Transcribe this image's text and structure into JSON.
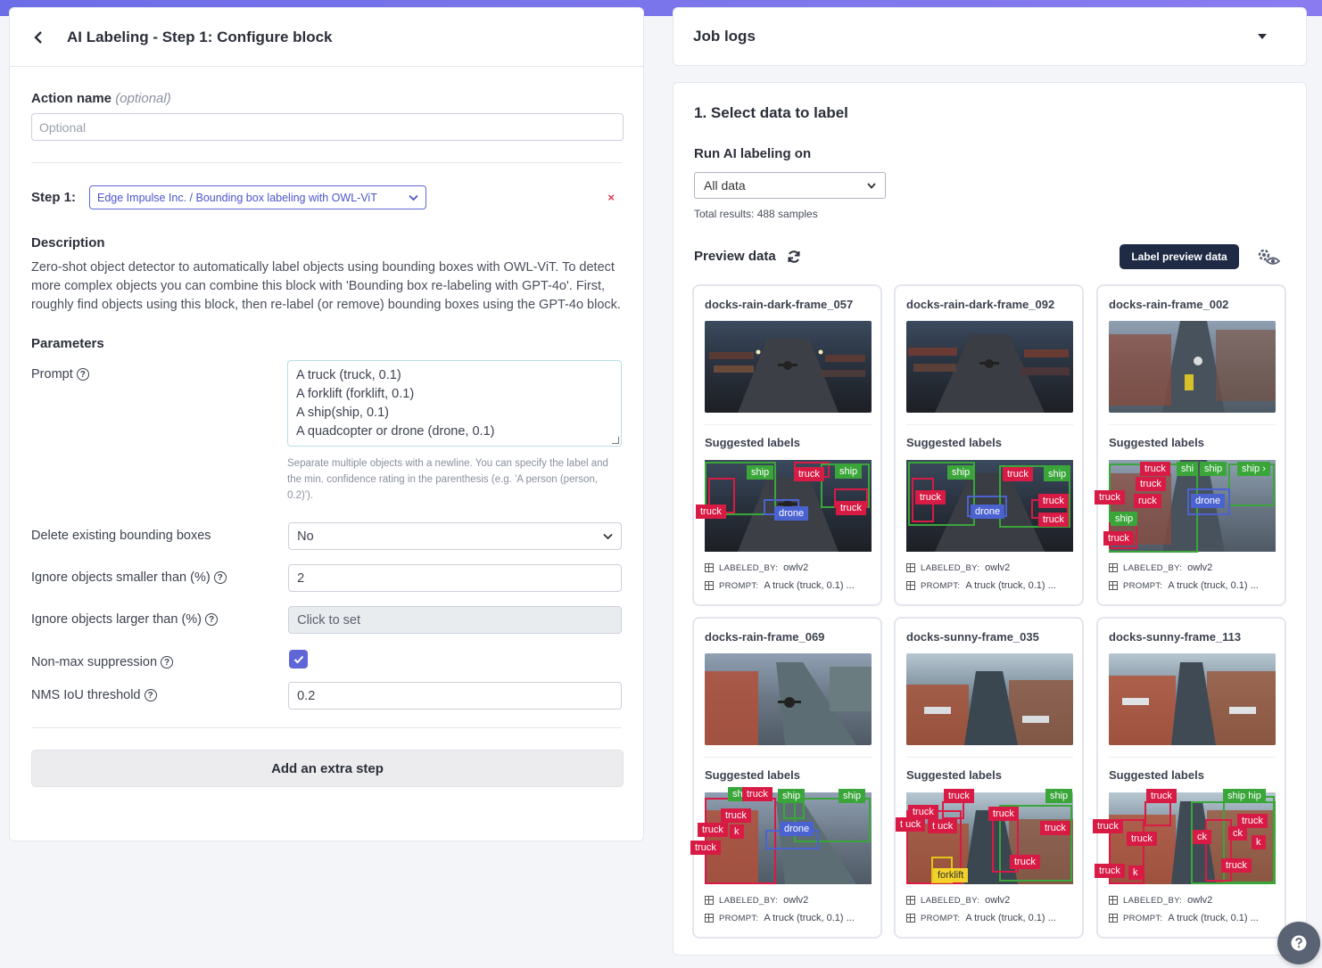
{
  "header": {
    "title": "AI Labeling - Step 1: Configure block"
  },
  "action_name": {
    "label": "Action name",
    "optional": "(optional)",
    "placeholder": "Optional"
  },
  "step": {
    "label": "Step 1:",
    "block": "Edge Impulse Inc. / Bounding box labeling with OWL-ViT",
    "remove": "×"
  },
  "description": {
    "heading": "Description",
    "text": "Zero-shot object detector to automatically label objects using bounding boxes with OWL-ViT. To detect more complex objects you can combine this block with 'Bounding box re-labeling with GPT-4o'. First, roughly find objects using this block, then re-label (or remove) bounding boxes using the GPT-4o block."
  },
  "parameters": {
    "heading": "Parameters",
    "prompt_label": "Prompt",
    "prompt_lines": [
      "A truck (truck, 0.1)",
      "A forklift (forklift, 0.1)",
      "A ship(ship, 0.1)",
      "A quadcopter or drone (drone, 0.1)"
    ],
    "prompt_hint": "Separate multiple objects with a newline. You can specify the label and the min. confidence rating in the parenthesis (e.g. 'A person (person, 0.2)').",
    "delete_label": "Delete existing bounding boxes",
    "delete_value": "No",
    "smaller_label": "Ignore objects smaller than (%)",
    "smaller_value": "2",
    "larger_label": "Ignore objects larger than (%)",
    "larger_value": "Click to set",
    "nms_label": "Non-max suppression",
    "nms_checked": true,
    "nms_iou_label": "NMS IoU threshold",
    "nms_iou_value": "0.2"
  },
  "add_step": "Add an extra step",
  "job_logs": {
    "title": "Job logs"
  },
  "select": {
    "title": "1. Select data to label",
    "run_label": "Run AI labeling on",
    "run_value": "All data",
    "total": "Total results: 488 samples",
    "preview_label": "Preview data",
    "label_button": "Label preview data"
  },
  "card_common": {
    "suggested": "Suggested labels",
    "labeled_by_key": "LABELED_BY:",
    "labeled_by_val": "owlv2",
    "prompt_key": "PROMPT:",
    "prompt_val": "A truck (truck, 0.1) ..."
  },
  "cards": [
    {
      "title": "docks-rain-dark-frame_057"
    },
    {
      "title": "docks-rain-dark-frame_092"
    },
    {
      "title": "docks-rain-frame_002"
    },
    {
      "title": "docks-rain-frame_069"
    },
    {
      "title": "docks-sunny-frame_035"
    },
    {
      "title": "docks-sunny-frame_113"
    }
  ],
  "tags": {
    "truck": "truck",
    "ship": "ship",
    "drone": "drone",
    "forklift": "forklift",
    "ship_partial": "shi",
    "ship_partial2": "hip",
    "truck_partial": "ruck",
    "truck_partial2": "k",
    "truck_partial3": "ck",
    "ship_arrow": "ship ›",
    "ship_hip": "ship hip",
    "drone_partial": "drone",
    "truck_partial4": "t uck",
    "truck_partial5": "t uck"
  },
  "colors": {
    "accent": "#5f67d8",
    "truck": "#d81b45",
    "ship": "#3aa63a",
    "drone": "#4b63d0",
    "forklift": "#f2d22a",
    "dark_button": "#1f2a44"
  }
}
